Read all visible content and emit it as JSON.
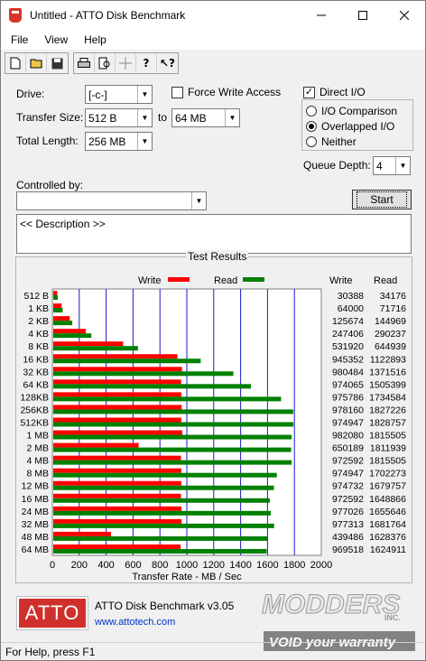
{
  "window": {
    "title": "Untitled - ATTO Disk Benchmark",
    "minimize_icon": "minimize-icon",
    "maximize_icon": "maximize-icon",
    "close_icon": "close-icon"
  },
  "menu": [
    "File",
    "View",
    "Help"
  ],
  "toolbar": {
    "icons": [
      "new-file-icon",
      "open-folder-icon",
      "save-icon",
      "print-icon",
      "print-preview-icon",
      "move-icon",
      "help-icon",
      "context-help-icon"
    ]
  },
  "settings": {
    "drive_label": "Drive:",
    "drive_value": "[-c-]",
    "force_write_access_label": "Force Write Access",
    "force_write_access_checked": false,
    "direct_io_label": "Direct I/O",
    "direct_io_checked": true,
    "transfer_size_label": "Transfer Size:",
    "transfer_size_from": "512 B",
    "transfer_size_to_label": "to",
    "transfer_size_to": "64 MB",
    "total_length_label": "Total Length:",
    "total_length_value": "256 MB",
    "io_comparison_label": "I/O Comparison",
    "overlapped_io_label": "Overlapped I/O",
    "neither_label": "Neither",
    "io_mode_selected": "Overlapped I/O",
    "queue_depth_label": "Queue Depth:",
    "queue_depth_value": "4",
    "controlled_by_label": "Controlled by:",
    "controlled_by_value": "",
    "start_label": "Start",
    "description_text": "<< Description >>"
  },
  "results": {
    "group_title": "Test Results",
    "legend_write": "Write",
    "legend_read": "Read",
    "col_write": "Write",
    "col_read": "Read",
    "write_color": "#ff0000",
    "read_color": "#008000",
    "axis_label": "Transfer Rate - MB / Sec"
  },
  "chart_data": {
    "type": "bar",
    "orientation": "horizontal",
    "xlabel": "Transfer Rate - MB / Sec",
    "xlim": [
      0,
      2000
    ],
    "xticks": [
      0,
      200,
      400,
      600,
      800,
      1000,
      1200,
      1400,
      1600,
      1800,
      2000
    ],
    "categories": [
      "512 B",
      "1 KB",
      "2 KB",
      "4 KB",
      "8 KB",
      "16 KB",
      "32 KB",
      "64 KB",
      "128KB",
      "256KB",
      "512KB",
      "1 MB",
      "2 MB",
      "4 MB",
      "8 MB",
      "12 MB",
      "16 MB",
      "24 MB",
      "32 MB",
      "48 MB",
      "64 MB"
    ],
    "series": [
      {
        "name": "Write",
        "color": "#ff0000",
        "values_kb": [
          30388,
          64000,
          125674,
          247406,
          531920,
          945352,
          980484,
          974065,
          975786,
          978160,
          974947,
          982080,
          650189,
          972592,
          974947,
          974732,
          972592,
          977026,
          977313,
          439486,
          969518
        ]
      },
      {
        "name": "Read",
        "color": "#008000",
        "values_kb": [
          34176,
          71716,
          144969,
          290237,
          644939,
          1122893,
          1371516,
          1505399,
          1734584,
          1827226,
          1828757,
          1815505,
          1811939,
          1815505,
          1702273,
          1679757,
          1648866,
          1655646,
          1681764,
          1628376,
          1624911
        ]
      }
    ],
    "grid": true,
    "legend": "top"
  },
  "footer": {
    "logo_text": "ATTO",
    "app_version": "ATTO Disk Benchmark v3.05",
    "website": "www.attotech.com",
    "watermark_line1": "MODDERS",
    "watermark_line2": "INC.",
    "watermark_line3": "VOID your warranty"
  },
  "status": {
    "text": "For Help, press F1"
  }
}
